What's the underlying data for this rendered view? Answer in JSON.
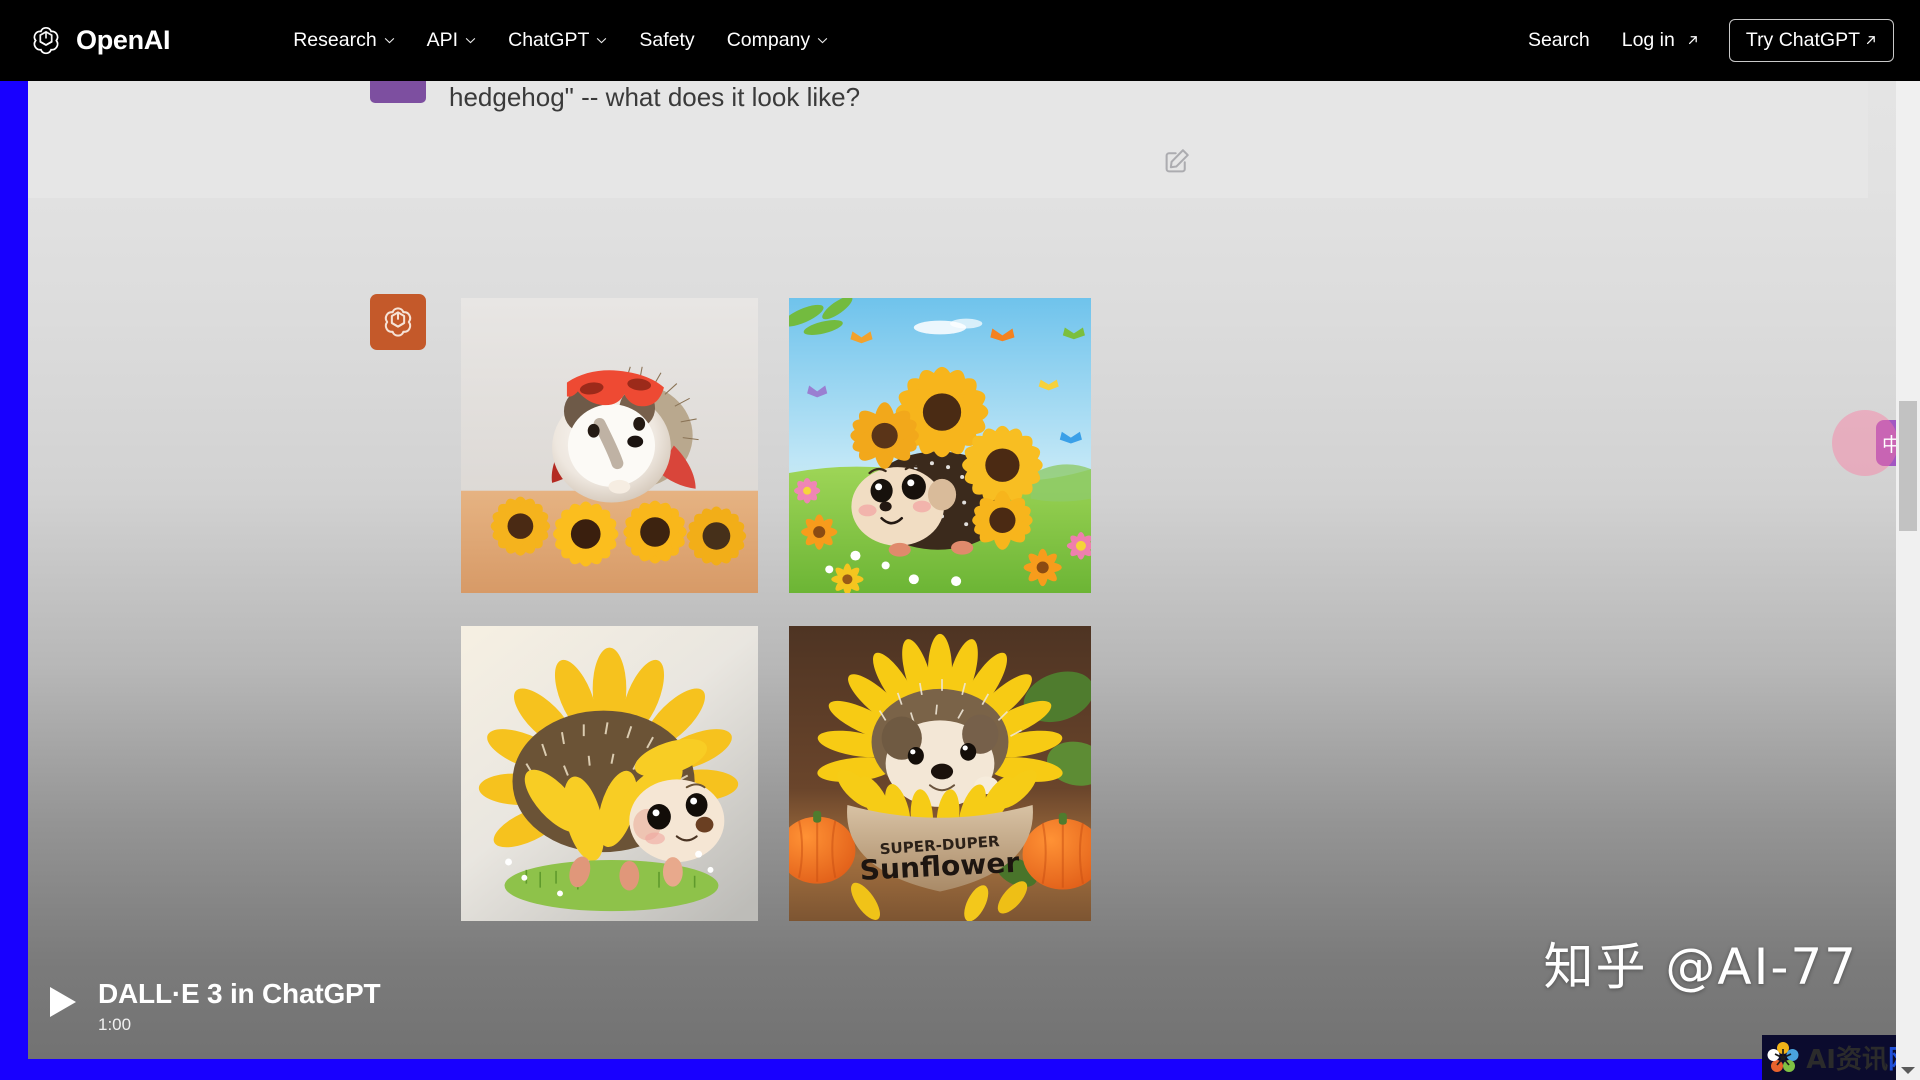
{
  "nav": {
    "brand": "OpenAI",
    "brand_logo_icon": "openai-logo-icon",
    "items": [
      {
        "label": "Research",
        "caret": true
      },
      {
        "label": "API",
        "caret": true
      },
      {
        "label": "ChatGPT",
        "caret": true
      },
      {
        "label": "Safety",
        "caret": false
      },
      {
        "label": "Company",
        "caret": true
      }
    ],
    "search_label": "Search",
    "login_label": "Log in",
    "login_arrow": "↗",
    "try_label": "Try ChatGPT",
    "try_arrow": "↗"
  },
  "conversation": {
    "user": {
      "avatar_icon": "user-avatar",
      "avatar_color": "#7d4fa0",
      "message": "hedgehog\" -- what does it look like?"
    },
    "edit_icon": "edit-pencil-icon",
    "assistant": {
      "avatar_icon": "openai-mark-icon",
      "avatar_color": "#c4592a",
      "images": [
        {
          "id": "image-1",
          "alt": "Photorealistic hedgehog wearing a red superhero mask and cape, sitting behind a row of sunflowers",
          "style": "photoreal"
        },
        {
          "id": "image-2",
          "alt": "Cartoon hedgehog with sunflowers for spines walking through a flower meadow with butterflies",
          "style": "cartoon"
        },
        {
          "id": "image-3",
          "alt": "Illustrated hedgehog with large yellow sunflower petals as quills standing on grass",
          "style": "illustration"
        },
        {
          "id": "image-4",
          "alt": "Hedgehog peeking out of a sunflower-shaped bowl labelled SUPER-DUPER Sunflower, with pumpkins",
          "style": "photoreal",
          "caption_line1": "SUPER-DUPER",
          "caption_line2": "Sunflower"
        }
      ]
    }
  },
  "video": {
    "play_icon": "play-triangle-icon",
    "title": "DALL·E 3 in ChatGPT",
    "duration": "1:00"
  },
  "watermarks": {
    "zhihu": "知乎 @AI-77",
    "badge_text_dark": "AI资讯",
    "badge_text_blue": "网",
    "badge_icon": "flower-logo-icon"
  },
  "floating": {
    "translate_icon": "translate-icon",
    "translate_label": "中A"
  },
  "colors": {
    "frame_blue": "#1800ff",
    "nav_bg": "#000000",
    "assistant_orange": "#c4592a",
    "user_purple": "#7d4fa0"
  }
}
